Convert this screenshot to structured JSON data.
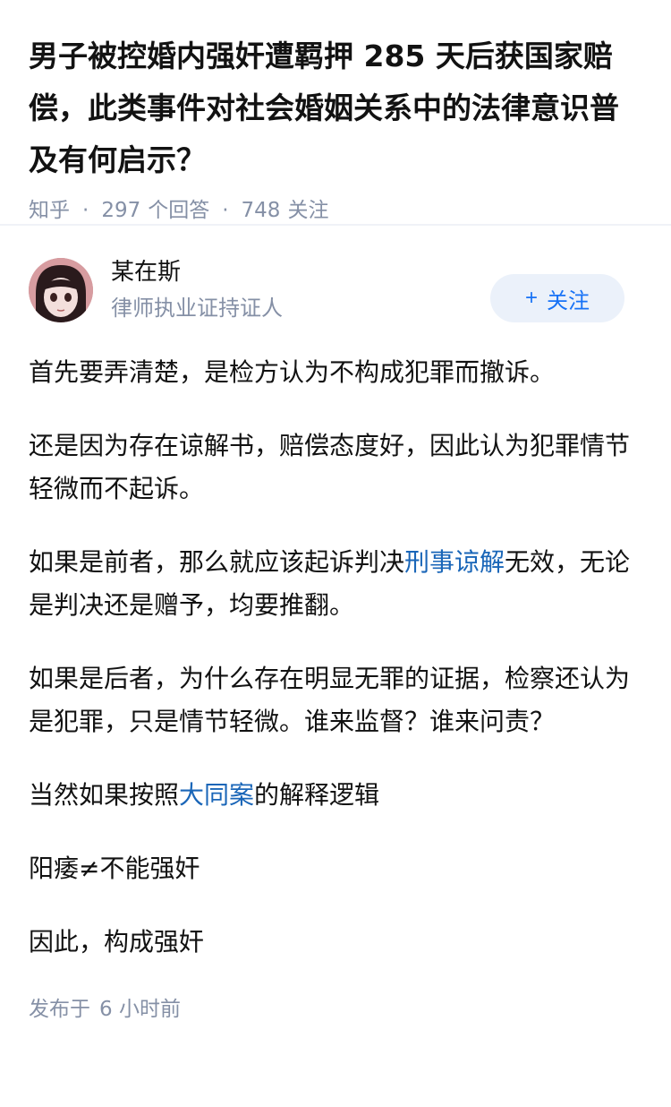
{
  "question": {
    "title": "男子被控婚内强奸遭羁押 285 天后获国家赔偿，此类事件对社会婚姻关系中的法律意识普及有何启示？",
    "source": "知乎",
    "answers_count": "297",
    "answers_label": "个回答",
    "follows_count": "748",
    "follows_label": "关注"
  },
  "author": {
    "name": "某在斯",
    "badge": "律师执业证持证人",
    "follow_button": "关注",
    "follow_icon": "plus-icon"
  },
  "content": {
    "p1": "首先要弄清楚，是检方认为不构成犯罪而撤诉。",
    "p2": "还是因为存在谅解书，赔偿态度好，因此认为犯罪情节轻微而不起诉。",
    "p3_before": "如果是前者，那么就应该起诉判决",
    "p3_link": "刑事谅解",
    "p3_after": "无效，无论是判决还是赠予，均要推翻。",
    "p4": "如果是后者，为什么存在明显无罪的证据，检察还认为是犯罪，只是情节轻微。谁来监督？谁来问责？",
    "p5_before": "当然如果按照",
    "p5_link": "大同案",
    "p5_after": "的解释逻辑",
    "p6": "阳痿≠不能强奸",
    "p7": "因此，构成强奸"
  },
  "publish": {
    "label": "发布于",
    "time": "6 小时前"
  },
  "colors": {
    "link": "#1a66b8",
    "accent": "#1772f6",
    "meta": "#8590a6"
  }
}
